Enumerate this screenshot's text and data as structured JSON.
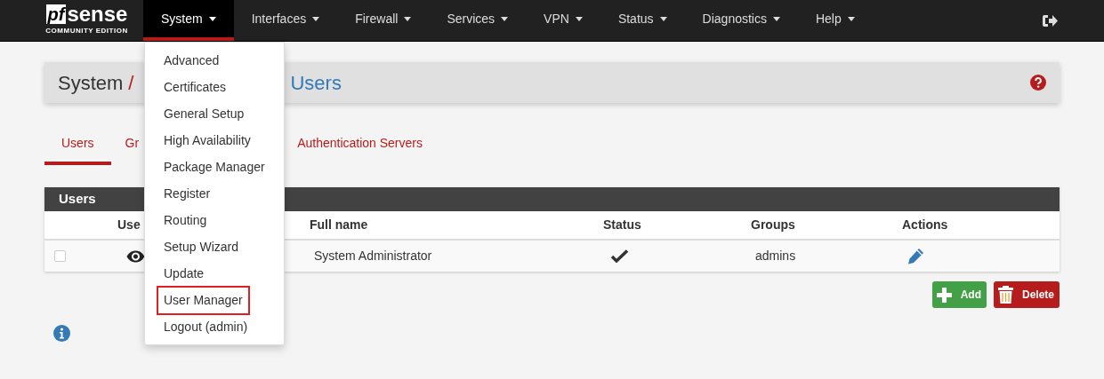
{
  "navbar": {
    "logo": {
      "mark": "pf",
      "name": "sense",
      "subtitle": "COMMUNITY EDITION"
    },
    "items": [
      {
        "label": "System",
        "selected": true
      },
      {
        "label": "Interfaces",
        "selected": false
      },
      {
        "label": "Firewall",
        "selected": false
      },
      {
        "label": "Services",
        "selected": false
      },
      {
        "label": "VPN",
        "selected": false
      },
      {
        "label": "Status",
        "selected": false
      },
      {
        "label": "Diagnostics",
        "selected": false
      },
      {
        "label": "Help",
        "selected": false
      }
    ]
  },
  "dropdown": [
    {
      "label": "Advanced",
      "highlighted": false
    },
    {
      "label": "Certificates",
      "highlighted": false
    },
    {
      "label": "General Setup",
      "highlighted": false
    },
    {
      "label": "High Availability",
      "highlighted": false
    },
    {
      "label": "Package Manager",
      "highlighted": false
    },
    {
      "label": "Register",
      "highlighted": false
    },
    {
      "label": "Routing",
      "highlighted": false
    },
    {
      "label": "Setup Wizard",
      "highlighted": false
    },
    {
      "label": "Update",
      "highlighted": false
    },
    {
      "label": "User Manager",
      "highlighted": true
    },
    {
      "label": "Logout (admin)",
      "highlighted": false
    }
  ],
  "breadcrumb": {
    "root": "System",
    "separator": "/",
    "current": "Users"
  },
  "tabs": [
    {
      "label": "Users",
      "selected": true
    },
    {
      "label": "Gr",
      "selected": false
    },
    {
      "label": "Authentication Servers",
      "selected": false
    }
  ],
  "table": {
    "title": "Users",
    "columns": [
      "Use",
      "Full name",
      "Status",
      "Groups",
      "Actions"
    ],
    "rows": [
      {
        "checked": false,
        "full_name": "System Administrator",
        "enabled": true,
        "groups": "admins"
      }
    ]
  },
  "buttons": [
    {
      "label": "Add",
      "kind": "add"
    },
    {
      "label": "Delete",
      "kind": "delete"
    }
  ]
}
